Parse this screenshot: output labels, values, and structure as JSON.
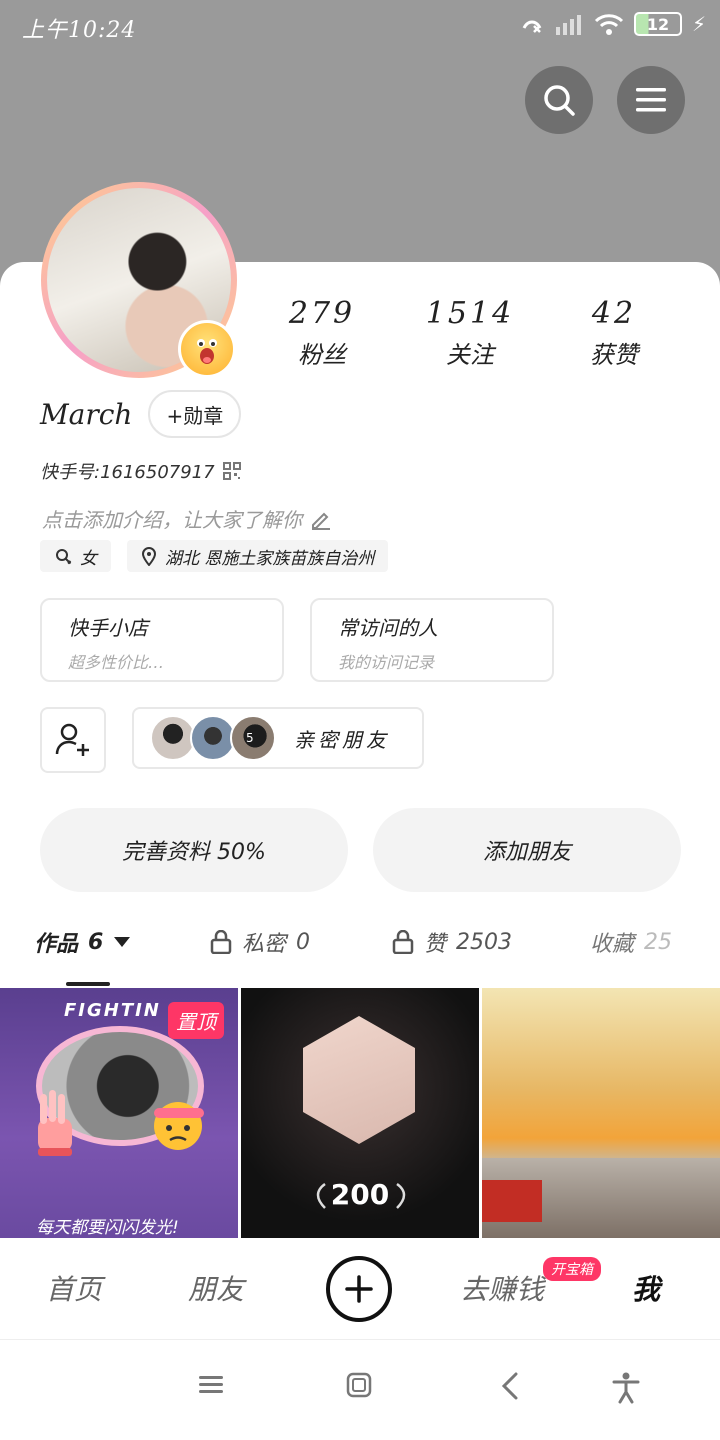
{
  "status_bar": {
    "time": "上午10:24",
    "battery": "12"
  },
  "profile": {
    "name": "March",
    "medal_button": "+勋章",
    "kuaishou_id": "快手号:1616507917",
    "bio_placeholder": "点击添加介绍，让大家了解你",
    "gender_tag": "女",
    "location_tag": "湖北 恩施土家族苗族自治州"
  },
  "stats": [
    {
      "value": "279",
      "label": "粉丝"
    },
    {
      "value": "1514",
      "label": "关注"
    },
    {
      "value": "42",
      "label": "获赞"
    }
  ],
  "boxes": [
    {
      "title": "快手小店",
      "subtitle": "超多性价比…"
    },
    {
      "title": "常访问的人",
      "subtitle": "我的访问记录"
    }
  ],
  "close_friends": {
    "count": "5",
    "label": "亲密朋友"
  },
  "actions": {
    "complete_profile": "完善资料 50%",
    "add_friends": "添加朋友"
  },
  "tabs": [
    {
      "label": "作品",
      "count": "6"
    },
    {
      "label": "私密",
      "count": "0"
    },
    {
      "label": "赞",
      "count": "2503"
    },
    {
      "label": "收藏",
      "count": "25"
    }
  ],
  "grid": {
    "item1": {
      "banner": "FIGHTIN",
      "pinned_label": "置顶",
      "caption": "每天都要闪闪发光!"
    },
    "item2": {
      "count": "200"
    }
  },
  "bottom_nav": {
    "home": "首页",
    "friends": "朋友",
    "earn": "去赚钱",
    "earn_badge": "开宝箱",
    "me": "我"
  },
  "colors": {
    "accent": "#fe3666",
    "header_bg": "#9a9a9a"
  }
}
